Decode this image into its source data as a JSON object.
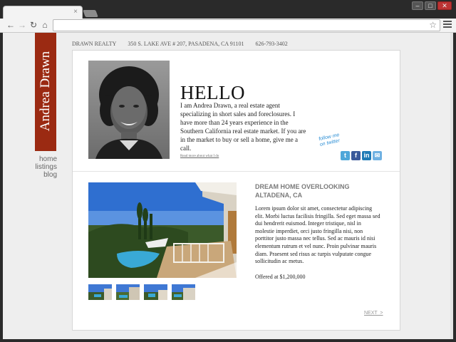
{
  "browser": {
    "tab_close": "×",
    "nav": {
      "back": "←",
      "forward": "→",
      "reload": "↻",
      "home": "⌂"
    },
    "url": "",
    "star": "☆",
    "window_controls": {
      "minimize": "–",
      "maximize": "□",
      "close": "✕"
    }
  },
  "site": {
    "brand": "Andrea Drawn",
    "nav": [
      {
        "label": "home"
      },
      {
        "label": "listings"
      },
      {
        "label": "blog"
      }
    ],
    "topline": {
      "company": "DRAWN REALTY",
      "address": "350 S. LAKE AVE # 207, PASADENA, CA 91101",
      "phone": "626-793-3402"
    }
  },
  "hero": {
    "heading": "HELLO",
    "intro": "I am Andrea Drawn, a real estate agent specializing in short sales and foreclosures. I have more than 24 years experience in the Southern California real estate market. If you are in the market to buy or sell a home, give me a call.",
    "read_more": "Read more about what I do",
    "follow": "follow me\non twitter",
    "social": [
      {
        "icon": "twitter-icon",
        "glyph": "t",
        "color": "#4fa7d9"
      },
      {
        "icon": "facebook-icon",
        "glyph": "f",
        "color": "#3b5a9a"
      },
      {
        "icon": "linkedin-icon",
        "glyph": "in",
        "color": "#1f7bb6"
      },
      {
        "icon": "email-icon",
        "glyph": "✉",
        "color": "#6fb1e2"
      }
    ]
  },
  "listing": {
    "title": "DREAM HOME OVERLOOKING ALTADENA, CA",
    "description": "Lorem ipsum dolor sit amet, consectetur adipiscing elit. Morbi luctus facilisis fringilla. Sed eget massa sed dui hendrerit euismod. Integer tristique, nisl in molestie imperdiet, orci justo fringilla nisi, non porttitor justo massa nec tellus. Sed ac mauris id nisi elementum rutrum et vel nunc. Proin pulvinar mauris diam. Praesent sed risus ac turpis vulputate congue sollicitudin ac metus.",
    "price": "Offered at $1,200,000",
    "thumbnail_count": 4,
    "next": "NEXT  >"
  }
}
